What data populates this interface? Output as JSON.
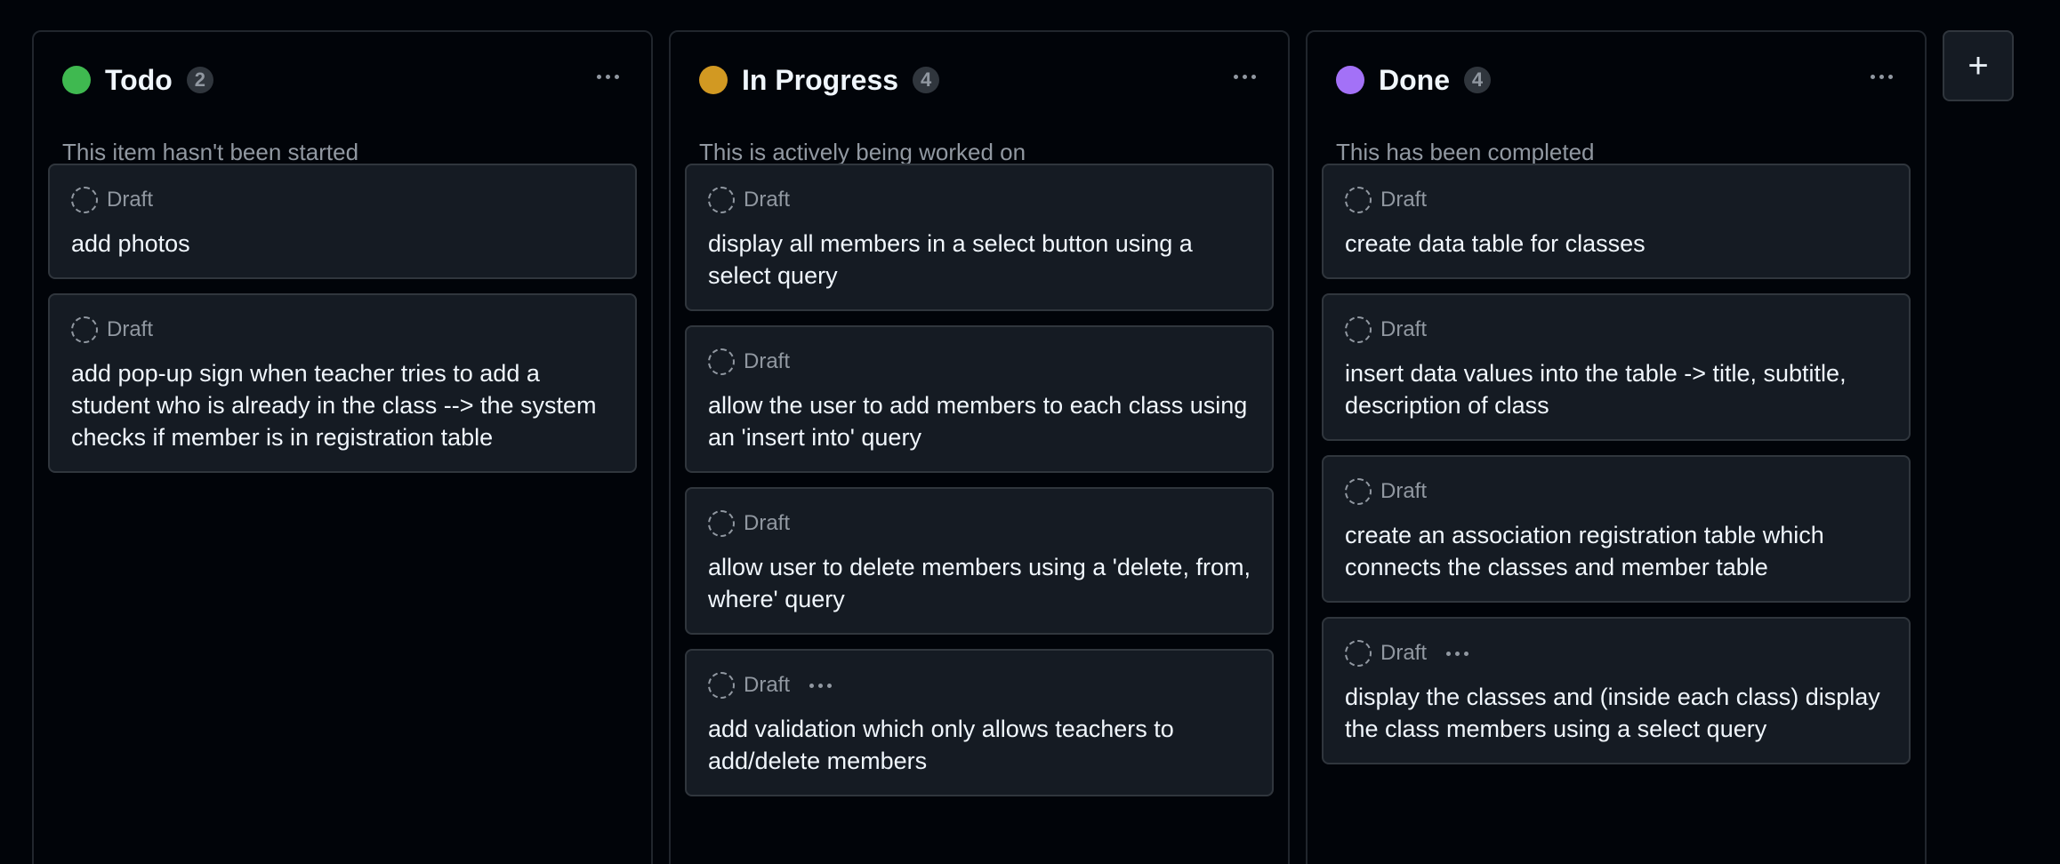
{
  "colors": {
    "background": "#010409",
    "card_bg": "#151b23",
    "border": "#30363d",
    "muted_text": "#9198a1",
    "todo_dot": "#3fb950",
    "in_progress_dot": "#d29922",
    "done_dot": "#a371f7"
  },
  "columns": [
    {
      "title": "Todo",
      "count": "2",
      "status_color": "#3fb950",
      "description": "This item hasn't been started",
      "cards": [
        {
          "label": "Draft",
          "title": "add photos",
          "has_menu": false
        },
        {
          "label": "Draft",
          "title": "add pop-up sign when teacher tries to add a student who is already in the class --> the system checks if member is in registration table",
          "has_menu": false
        }
      ]
    },
    {
      "title": "In Progress",
      "count": "4",
      "status_color": "#d29922",
      "description": "This is actively being worked on",
      "cards": [
        {
          "label": "Draft",
          "title": "display all members in a select button using a select query",
          "has_menu": false
        },
        {
          "label": "Draft",
          "title": "allow the user to add members to each class using an 'insert into' query",
          "has_menu": false
        },
        {
          "label": "Draft",
          "title": "allow user to delete members using a 'delete, from, where' query",
          "has_menu": false
        },
        {
          "label": "Draft",
          "title": "add validation which only allows teachers to add/delete members",
          "has_menu": true
        }
      ]
    },
    {
      "title": "Done",
      "count": "4",
      "status_color": "#a371f7",
      "description": "This has been completed",
      "cards": [
        {
          "label": "Draft",
          "title": "create data table for classes",
          "has_menu": false
        },
        {
          "label": "Draft",
          "title": "insert data values into the table -> title, subtitle, description of class",
          "has_menu": false
        },
        {
          "label": "Draft",
          "title": "create an association registration table which connects the classes and member table",
          "has_menu": false
        },
        {
          "label": "Draft",
          "title": "display the classes and (inside each class) display the class members using a select query",
          "has_menu": true
        }
      ]
    }
  ],
  "add_column": {
    "icon": "plus-icon",
    "symbol": "+"
  }
}
